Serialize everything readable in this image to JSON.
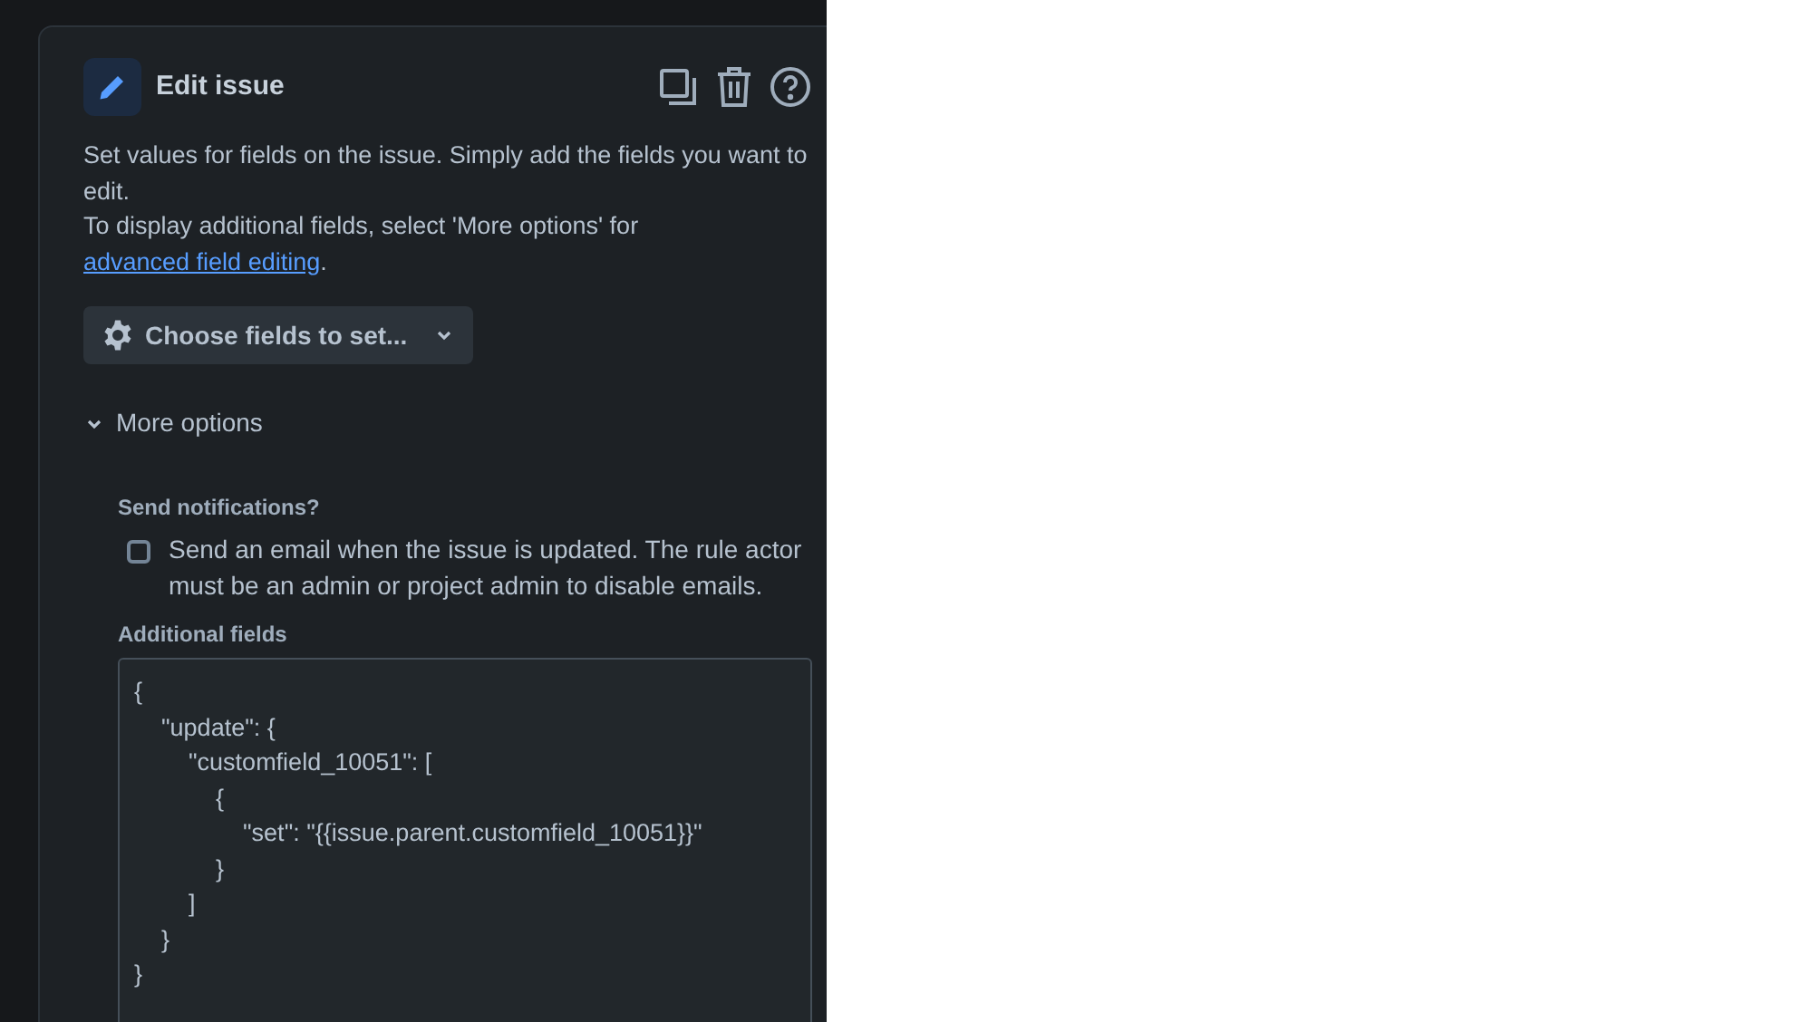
{
  "panel": {
    "title": "Edit issue",
    "description": "Set values for fields on the issue. Simply add the fields you want to edit.",
    "more_info": "To display additional fields, select 'More options' for ",
    "link": "advanced field editing",
    "link_suffix": ".",
    "choose_button": "Choose fields to set...",
    "more_options": {
      "label": "More options",
      "expanded": true
    },
    "notifications": {
      "label": "Send notifications?",
      "checkbox_label": "Send an email when the issue is updated. The rule actor must be an admin or project admin to disable emails.",
      "checked": false
    },
    "additional_fields": {
      "label": "Additional fields",
      "value": "{\n    \"update\": {\n        \"customfield_10051\": [\n            {\n                \"set\": \"{{issue.parent.customfield_10051}}\"\n            }\n        ]\n    }\n}"
    }
  }
}
